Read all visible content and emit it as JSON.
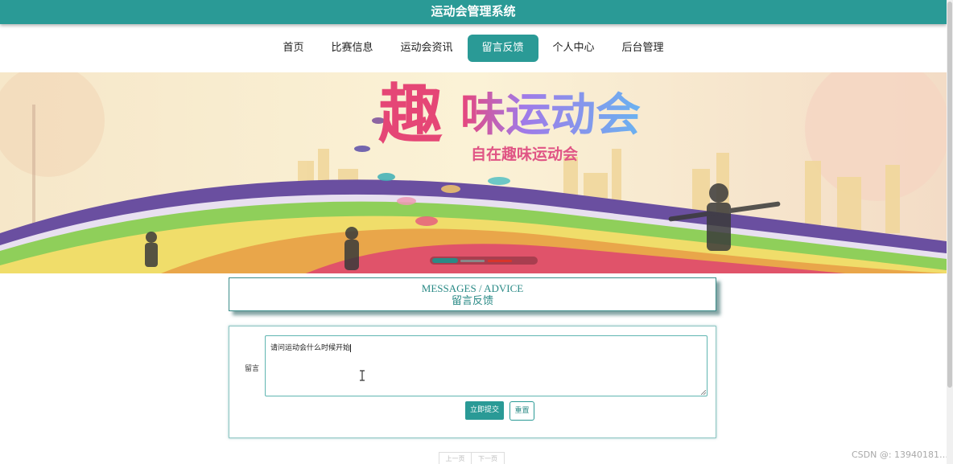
{
  "app": {
    "title": "运动会管理系统"
  },
  "nav": {
    "items": [
      {
        "label": "首页"
      },
      {
        "label": "比赛信息"
      },
      {
        "label": "运动会资讯"
      },
      {
        "label": "留言反馈"
      },
      {
        "label": "个人中心"
      },
      {
        "label": "后台管理"
      }
    ],
    "active_index": 3
  },
  "banner": {
    "headline_char": "趣",
    "headline_rest": "味运动会",
    "subheadline": "自在趣味运动会",
    "carousel_active_index": 0,
    "carousel_count": 3
  },
  "section": {
    "title_en": "MESSAGES / ADVICE",
    "title_zh": "留言反馈"
  },
  "form": {
    "label": "留言",
    "message_value": "请问运动会什么时候开始",
    "submit_label": "立即提交",
    "reset_label": "重置"
  },
  "pager": {
    "prev_label": "上一页",
    "next_label": "下一页"
  },
  "watermark": "CSDN @:  13940181…",
  "colors": {
    "accent": "#2a9a96",
    "heading_text": "#2a8a86"
  },
  "icons": [
    "text-cursor-icon",
    "resize-grip-icon",
    "sogou-ime-icon"
  ]
}
